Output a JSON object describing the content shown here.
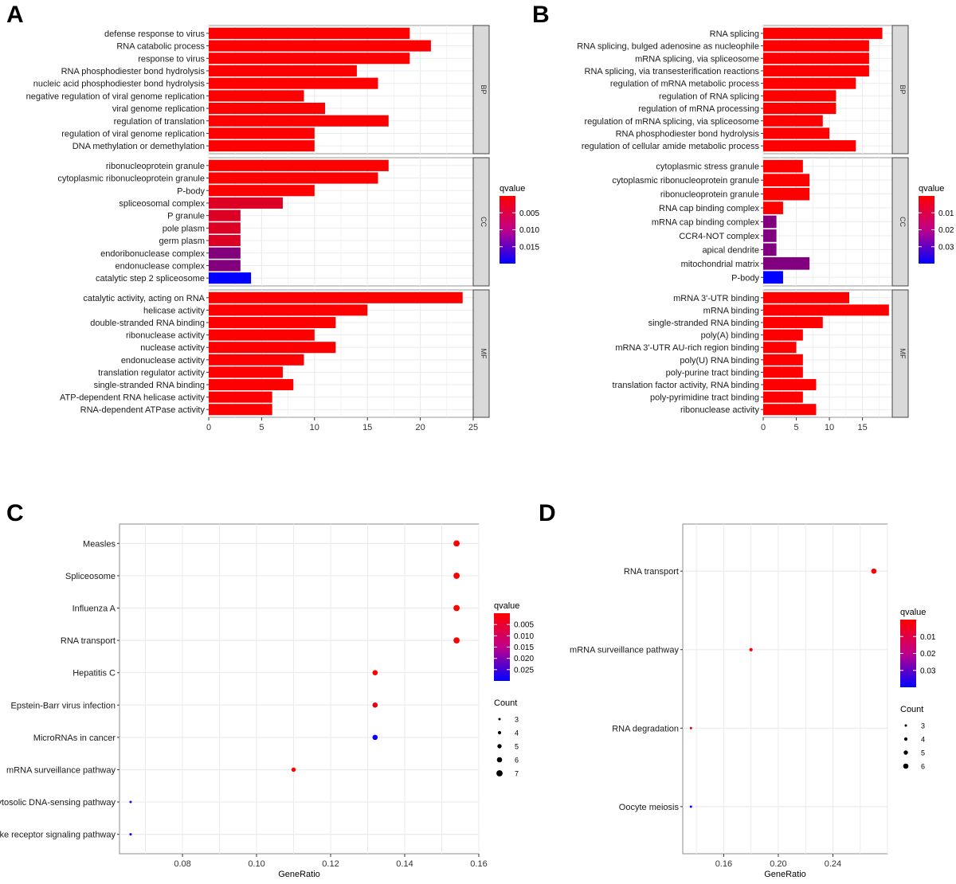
{
  "chart_data": [
    {
      "panel": "A",
      "type": "bar",
      "orientation": "horizontal",
      "xlim": [
        0,
        25
      ],
      "xticks": [
        0,
        5,
        10,
        15,
        20,
        25
      ],
      "xlabel": "",
      "ylabel": "",
      "grid": true,
      "color_legend": {
        "title": "qvalue",
        "ticks": [
          "0.005",
          "0.010",
          "0.015"
        ],
        "range": [
          0.0005,
          0.018
        ],
        "low_color": "#FF0000",
        "high_color": "#0000FF"
      },
      "facets": [
        {
          "name": "BP",
          "categories": [
            "defense response to virus",
            "RNA catabolic process",
            "response to virus",
            "RNA phosphodiester bond hydrolysis",
            "nucleic acid phosphodiester bond hydrolysis",
            "negative regulation of viral genome replication",
            "viral genome replication",
            "regulation of translation",
            "regulation of viral genome replication",
            "DNA methylation or demethylation"
          ],
          "values": [
            19,
            21,
            19,
            14,
            16,
            9,
            11,
            17,
            10,
            10
          ],
          "qvalue": [
            0.0005,
            0.0005,
            0.0005,
            0.0005,
            0.0005,
            0.0005,
            0.0005,
            0.0005,
            0.0005,
            0.0005
          ]
        },
        {
          "name": "CC",
          "categories": [
            "ribonucleoprotein granule",
            "cytoplasmic ribonucleoprotein granule",
            "P-body",
            "spliceosomal complex",
            "P granule",
            "pole plasm",
            "germ plasm",
            "endoribonuclease complex",
            "endonuclease complex",
            "catalytic step 2 spliceosome"
          ],
          "values": [
            17,
            16,
            10,
            7,
            3,
            3,
            3,
            3,
            3,
            4
          ],
          "qvalue": [
            0.0005,
            0.0005,
            0.0005,
            0.003,
            0.003,
            0.003,
            0.003,
            0.009,
            0.009,
            0.018
          ]
        },
        {
          "name": "MF",
          "categories": [
            "catalytic activity, acting on RNA",
            "helicase activity",
            "double-stranded RNA binding",
            "ribonuclease activity",
            "nuclease activity",
            "endonuclease activity",
            "translation regulator activity",
            "single-stranded RNA binding",
            "ATP-dependent RNA helicase activity",
            "RNA-dependent ATPase activity"
          ],
          "values": [
            24,
            15,
            12,
            10,
            12,
            9,
            7,
            8,
            6,
            6
          ],
          "qvalue": [
            0.0005,
            0.0005,
            0.0005,
            0.0005,
            0.0005,
            0.0005,
            0.0005,
            0.0005,
            0.0005,
            0.0005
          ]
        }
      ]
    },
    {
      "panel": "B",
      "type": "bar",
      "orientation": "horizontal",
      "xlim": [
        0,
        19.5
      ],
      "xticks": [
        0,
        5,
        10,
        15
      ],
      "xlabel": "",
      "ylabel": "",
      "grid": true,
      "color_legend": {
        "title": "qvalue",
        "ticks": [
          "0.01",
          "0.02",
          "0.03"
        ],
        "range": [
          0.001,
          0.037
        ],
        "low_color": "#FF0000",
        "high_color": "#0000FF"
      },
      "facets": [
        {
          "name": "BP",
          "categories": [
            "RNA splicing",
            "RNA splicing, bulged adenosine as nucleophile",
            "mRNA splicing, via spliceosome",
            "RNA splicing, via transesterification reactions",
            "regulation of mRNA metabolic process",
            "regulation of RNA splicing",
            "regulation of mRNA processing",
            "regulation of mRNA splicing, via spliceosome",
            "RNA phosphodiester bond hydrolysis",
            "regulation of cellular amide metabolic process"
          ],
          "values": [
            18,
            16,
            16,
            16,
            14,
            11,
            11,
            9,
            10,
            14
          ],
          "qvalue": [
            0.001,
            0.001,
            0.001,
            0.001,
            0.001,
            0.001,
            0.001,
            0.001,
            0.001,
            0.001
          ]
        },
        {
          "name": "CC",
          "categories": [
            "cytoplasmic stress granule",
            "cytoplasmic ribonucleoprotein granule",
            "ribonucleoprotein granule",
            "RNA cap binding complex",
            "mRNA cap binding complex",
            "CCR4-NOT complex",
            "apical dendrite",
            "mitochondrial matrix",
            "P-body"
          ],
          "values": [
            6,
            7,
            7,
            3,
            2,
            2,
            2,
            7,
            3
          ],
          "qvalue": [
            0.001,
            0.001,
            0.001,
            0.001,
            0.019,
            0.019,
            0.019,
            0.019,
            0.037
          ]
        },
        {
          "name": "MF",
          "categories": [
            "mRNA 3'-UTR binding",
            "mRNA binding",
            "single-stranded RNA binding",
            "poly(A) binding",
            "mRNA 3'-UTR AU-rich region binding",
            "poly(U) RNA binding",
            "poly-purine tract binding",
            "translation factor activity, RNA binding",
            "poly-pyrimidine tract binding",
            "ribonuclease activity"
          ],
          "values": [
            13,
            19,
            9,
            6,
            5,
            6,
            6,
            8,
            6,
            8
          ],
          "qvalue": [
            0.001,
            0.001,
            0.001,
            0.001,
            0.001,
            0.001,
            0.001,
            0.001,
            0.001,
            0.001
          ]
        }
      ]
    },
    {
      "panel": "C",
      "type": "scatter",
      "subtype": "dotplot",
      "xlabel": "GeneRatio",
      "ylabel": "",
      "xlim": [
        0.063,
        0.16
      ],
      "xticks": [
        "0.08",
        "0.10",
        "0.12",
        "0.14",
        "0.16"
      ],
      "grid": true,
      "categories": [
        "Measles",
        "Spliceosome",
        "Influenza A",
        "RNA transport",
        "Hepatitis C",
        "Epstein-Barr virus infection",
        "MicroRNAs in cancer",
        "mRNA surveillance pathway",
        "Cytosolic DNA-sensing pathway",
        "RIG-I-like receptor signaling pathway"
      ],
      "gene_ratio": [
        0.154,
        0.154,
        0.154,
        0.154,
        0.132,
        0.132,
        0.132,
        0.11,
        0.066,
        0.066
      ],
      "count": [
        7,
        7,
        7,
        7,
        6,
        6,
        6,
        5,
        3,
        3
      ],
      "qvalue": [
        0.0005,
        0.0005,
        0.0005,
        0.0005,
        0.0005,
        0.003,
        0.026,
        0.0005,
        0.022,
        0.026
      ],
      "color_legend": {
        "title": "qvalue",
        "ticks": [
          "0.005",
          "0.010",
          "0.015",
          "0.020",
          "0.025"
        ],
        "range": [
          0.0005,
          0.027
        ],
        "low_color": "#FF0000",
        "high_color": "#0000FF"
      },
      "size_legend": {
        "title": "Count",
        "values": [
          "3",
          "4",
          "5",
          "6",
          "7"
        ]
      }
    },
    {
      "panel": "D",
      "type": "scatter",
      "subtype": "dotplot",
      "xlabel": "GeneRatio",
      "ylabel": "",
      "xlim": [
        0.13,
        0.28
      ],
      "xticks": [
        "0.16",
        "0.20",
        "0.24"
      ],
      "grid": true,
      "categories": [
        "RNA transport",
        "mRNA surveillance pathway",
        "RNA degradation",
        "Oocyte meiosis"
      ],
      "gene_ratio": [
        0.27,
        0.18,
        0.136,
        0.136
      ],
      "count": [
        6,
        4,
        3,
        3
      ],
      "qvalue": [
        0.001,
        0.001,
        0.006,
        0.036
      ],
      "color_legend": {
        "title": "qvalue",
        "ticks": [
          "0.01",
          "0.02",
          "0.03"
        ],
        "range": [
          0.001,
          0.037
        ],
        "low_color": "#FF0000",
        "high_color": "#0000FF"
      },
      "size_legend": {
        "title": "Count",
        "values": [
          "3",
          "4",
          "5",
          "6"
        ]
      }
    }
  ]
}
